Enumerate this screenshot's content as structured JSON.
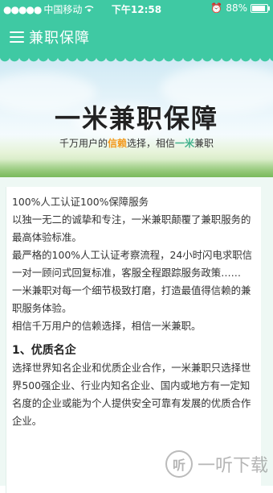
{
  "status": {
    "carrier": "中国移动",
    "time": "下午12:58",
    "battery": "88%",
    "battery_level": 0.88
  },
  "header": {
    "title": "兼职保障"
  },
  "banner": {
    "title": "一米兼职保障",
    "subtitle_parts": [
      "千万用户的",
      "信赖",
      "选择，相信",
      "一米",
      "兼职"
    ]
  },
  "content": {
    "paragraphs": [
      "100%人工认证100%保障服务",
      "以独一无二的诚挚和专注，一米兼职颠覆了兼职服务的最高体验标准。",
      "最严格的100%人工认证考察流程，24小时闪电求职信一对一顾问式回复标准，客服全程跟踪服务政策……",
      "一米兼职对每一个细节极致打磨，打造最值得信赖的兼职服务体验。",
      "相信千万用户的信赖选择，相信一米兼职。"
    ],
    "section1_title": "1、优质名企",
    "section1_text": "选择世界知名企业和优质企业合作，一米兼职只选择世界500强企业、行业内知名企业、国内或地方有一定知名度的企业或能为个人提供安全可靠有发展的优质合作企业。"
  },
  "watermark": {
    "logo": "听",
    "text": "一听下载"
  },
  "colors": {
    "primary": "#3fc9a3",
    "orange": "#f39a1f"
  }
}
